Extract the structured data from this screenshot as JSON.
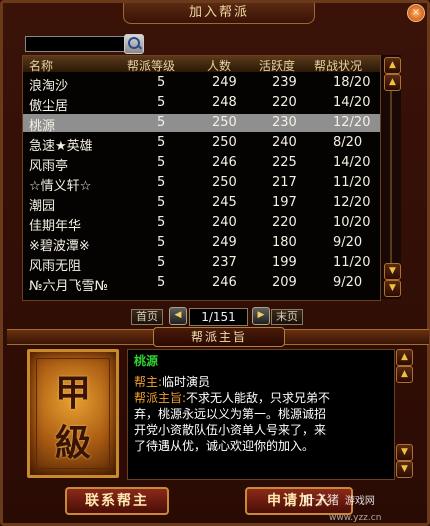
{
  "window": {
    "title": "加入帮派",
    "close_glyph": "×"
  },
  "search": {
    "value": "",
    "placeholder": ""
  },
  "table": {
    "columns": [
      "名称",
      "帮派等级",
      "人数",
      "活跃度",
      "帮战状况"
    ],
    "rows": [
      {
        "name": "浪淘沙",
        "level": "5",
        "members": "249",
        "activity": "239",
        "war": "18/20"
      },
      {
        "name": "傲尘居",
        "level": "5",
        "members": "248",
        "activity": "220",
        "war": "14/20"
      },
      {
        "name": "桃源",
        "level": "5",
        "members": "250",
        "activity": "230",
        "war": "12/20"
      },
      {
        "name": "急速★英雄",
        "level": "5",
        "members": "250",
        "activity": "240",
        "war": "8/20"
      },
      {
        "name": "风雨亭",
        "level": "5",
        "members": "246",
        "activity": "225",
        "war": "14/20"
      },
      {
        "name": "☆情义轩☆",
        "level": "5",
        "members": "250",
        "activity": "217",
        "war": "11/20"
      },
      {
        "name": "潮园",
        "level": "5",
        "members": "245",
        "activity": "197",
        "war": "12/20"
      },
      {
        "name": "佳期年华",
        "level": "5",
        "members": "240",
        "activity": "220",
        "war": "10/20"
      },
      {
        "name": "※碧波潭※",
        "level": "5",
        "members": "249",
        "activity": "180",
        "war": "9/20"
      },
      {
        "name": "风雨无阻",
        "level": "5",
        "members": "237",
        "activity": "199",
        "war": "11/20"
      },
      {
        "name": "№六月飞雪№",
        "level": "5",
        "members": "246",
        "activity": "209",
        "war": "9/20"
      }
    ],
    "selected_index": 2
  },
  "pager": {
    "first_label": "首页",
    "last_label": "末页",
    "page_indicator": "1/151",
    "prev_glyph": "◀",
    "next_glyph": "▶"
  },
  "detail": {
    "section_title": "帮派主旨",
    "emblem_chars": [
      "甲",
      "級"
    ],
    "guild_name": "桃源",
    "leader_label": "帮主:",
    "leader_value": "临时演员",
    "motto_label": "帮派主旨:",
    "motto_lines": [
      "不求无人能敌，只求兄弟不",
      "弃，桃源永远以义为第一。桃源诚招",
      "开党小资散队伍小资单人号来了，来",
      "了待遇从优，诚心欢迎你的加入。"
    ]
  },
  "buttons": {
    "contact_leader": "联系帮主",
    "apply_join": "申请加入"
  },
  "watermark": {
    "brand": "叶子猪",
    "tag": "游戏网",
    "site": "www.yzz.cn"
  },
  "scroll_glyphs": {
    "up_double": "▲",
    "up": "▲",
    "down": "▼",
    "down_double": "▼"
  },
  "colors": {
    "accent_green": "#30d030",
    "label_orange": "#f0a030",
    "selected_row": "#8f8f8f"
  }
}
